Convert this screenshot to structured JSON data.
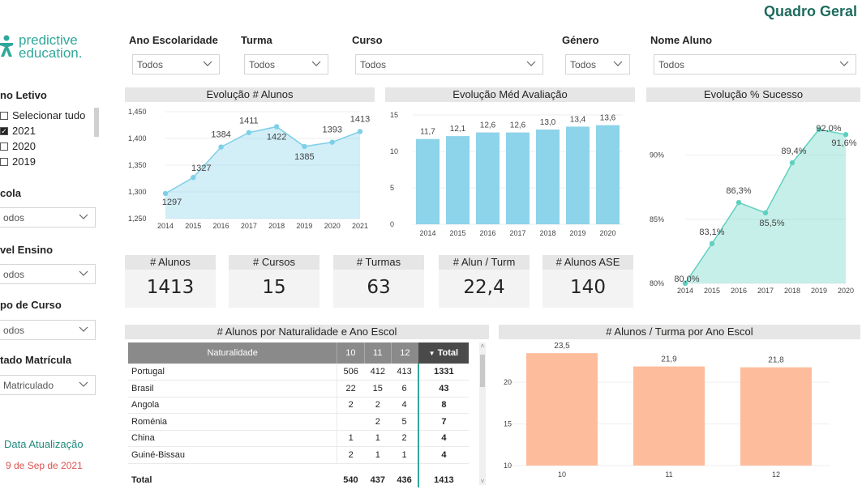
{
  "header": {
    "title": "Quadro Geral"
  },
  "logo": {
    "line1": "predictive",
    "line2": "education."
  },
  "filters": {
    "ano_escolaridade": {
      "label": "Ano Escolaridade",
      "value": "Todos"
    },
    "turma": {
      "label": "Turma",
      "value": "Todos"
    },
    "curso": {
      "label": "Curso",
      "value": "Todos"
    },
    "genero": {
      "label": "Género",
      "value": "Todos"
    },
    "nome_aluno": {
      "label": "Nome Aluno",
      "value": "Todos"
    }
  },
  "sidebar": {
    "ano_letivo": {
      "label": "no Letivo",
      "options": [
        {
          "label": "Selecionar tudo",
          "checked": false
        },
        {
          "label": "2021",
          "checked": true
        },
        {
          "label": "2020",
          "checked": false
        },
        {
          "label": "2019",
          "checked": false
        }
      ]
    },
    "escola": {
      "label": "cola",
      "value": "odos"
    },
    "nivel_ensino": {
      "label": "vel Ensino",
      "value": "odos"
    },
    "tipo_curso": {
      "label": "po de Curso",
      "value": "odos"
    },
    "estado_matricula": {
      "label": "tado Matrícula",
      "value": "Matriculado"
    },
    "update": {
      "label": "Data Atualização",
      "date": "9 de Sep de 2021"
    }
  },
  "kpis": [
    {
      "label": "# Alunos",
      "value": "1413"
    },
    {
      "label": "# Cursos",
      "value": "15"
    },
    {
      "label": "# Turmas",
      "value": "63"
    },
    {
      "label": "# Alun / Turm",
      "value": "22,4"
    },
    {
      "label": "# Alunos ASE",
      "value": "140"
    }
  ],
  "chart_data": [
    {
      "type": "area",
      "title": "Evolução # Alunos",
      "x": [
        "2014",
        "2015",
        "2016",
        "2017",
        "2018",
        "2019",
        "2020",
        "2021"
      ],
      "values": [
        1297,
        1327,
        1384,
        1411,
        1422,
        1385,
        1393,
        1413
      ],
      "value_labels": [
        "1297",
        "1327",
        "1384",
        "1411",
        "1422",
        "1385",
        "1393",
        "1413"
      ],
      "yticks": [
        "1,450",
        "1,400",
        "1,350",
        "1,300",
        "1,250"
      ],
      "ylim": [
        1250,
        1450
      ],
      "color": "#7ecfe8"
    },
    {
      "type": "bar",
      "title": "Evolução Méd Avaliação",
      "categories": [
        "2014",
        "2015",
        "2016",
        "2017",
        "2018",
        "2019",
        "2020"
      ],
      "values": [
        11.7,
        12.1,
        12.6,
        12.6,
        13.0,
        13.4,
        13.6
      ],
      "value_labels": [
        "11,7",
        "12,1",
        "12,6",
        "12,6",
        "13,0",
        "13,4",
        "13,6"
      ],
      "yticks": [
        "15",
        "10",
        "5",
        "0"
      ],
      "ylim": [
        0,
        15
      ],
      "color": "#8dd3ea"
    },
    {
      "type": "area",
      "title": "Evolução % Sucesso",
      "x": [
        "2014",
        "2015",
        "2016",
        "2017",
        "2018",
        "2019",
        "2020"
      ],
      "values": [
        80.0,
        83.1,
        86.3,
        85.5,
        89.4,
        92.0,
        91.6
      ],
      "value_labels": [
        "80,0%",
        "83,1%",
        "86,3%",
        "85,5%",
        "89,4%",
        "92,0%",
        "91,6%"
      ],
      "yticks": [
        "90%",
        "85%",
        "80%"
      ],
      "ylim": [
        80,
        93
      ],
      "color": "#5fd0bf"
    },
    {
      "type": "table",
      "title": "# Alunos por Naturalidade e Ano Escol",
      "columns": [
        "Naturalidade",
        "10",
        "11",
        "12",
        "Total"
      ],
      "rows": [
        [
          "Portugal",
          "506",
          "412",
          "413",
          "1331"
        ],
        [
          "Brasil",
          "22",
          "15",
          "6",
          "43"
        ],
        [
          "Angola",
          "2",
          "2",
          "4",
          "8"
        ],
        [
          "Roménia",
          "",
          "2",
          "5",
          "7"
        ],
        [
          "China",
          "1",
          "1",
          "2",
          "4"
        ],
        [
          "Guiné-Bissau",
          "2",
          "1",
          "1",
          "4"
        ]
      ],
      "total": [
        "Total",
        "540",
        "437",
        "436",
        "1413"
      ]
    },
    {
      "type": "bar",
      "title": "# Alunos / Turma por Ano Escol",
      "categories": [
        "10",
        "11",
        "12"
      ],
      "values": [
        23.5,
        21.9,
        21.8
      ],
      "value_labels": [
        "23,5",
        "21,9",
        "21,8"
      ],
      "yticks": [
        "20",
        "15",
        "10"
      ],
      "ylim": [
        10,
        24
      ],
      "color": "#fdbd9c"
    }
  ]
}
